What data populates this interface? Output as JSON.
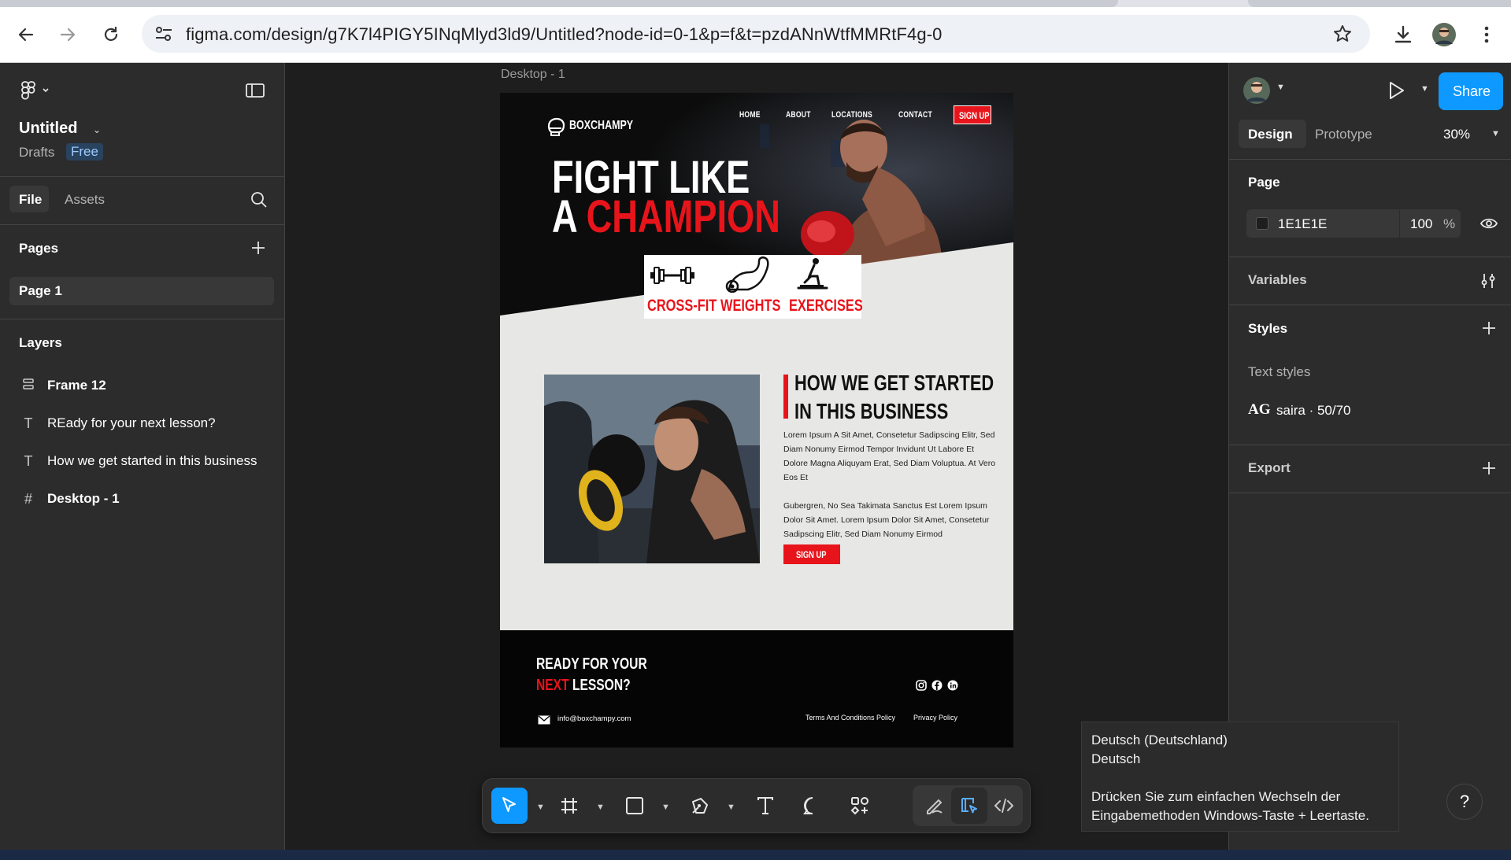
{
  "browser": {
    "url": "figma.com/design/g7K7l4PIGY5INqMlyd3ld9/Untitled?node-id=0-1&p=f&t=pzdANnWtfMMRtF4g-0"
  },
  "file": {
    "title": "Untitled",
    "location": "Drafts",
    "plan_badge": "Free"
  },
  "left_tabs": {
    "file": "File",
    "assets": "Assets"
  },
  "pages": {
    "heading": "Pages",
    "items": [
      "Page 1"
    ]
  },
  "layers": {
    "heading": "Layers",
    "items": [
      {
        "name": "Frame 12",
        "icon": "frame-icon"
      },
      {
        "name": "REady for your next lesson?",
        "icon": "text-icon"
      },
      {
        "name": "How we get started in this business",
        "icon": "text-icon"
      },
      {
        "name": "Desktop - 1",
        "icon": "hash-frame-icon"
      }
    ]
  },
  "canvas": {
    "frame_label": "Desktop - 1"
  },
  "site": {
    "logo": "BOXCHAMPY",
    "nav": [
      "HOME",
      "ABOUT",
      "LOCATIONS",
      "CONTACT"
    ],
    "nav_cta": "SIGN UP",
    "hero_line1": "FIGHT LIKE",
    "hero_line2_white": "A ",
    "hero_line2_red": "CHAMPION",
    "features": [
      "CROSS-FIT",
      "WEIGHTS",
      "EXERCISES"
    ],
    "about_title_1": "HOW WE GET STARTED",
    "about_title_2": "IN THIS BUSINESS",
    "about_p1": "Lorem Ipsum A Sit Amet, Consetetur Sadipscing Elitr, Sed Diam Nonumy Eirmod Tempor Invidunt Ut Labore Et Dolore Magna Aliquyam Erat, Sed Diam Voluptua. At Vero Eos Et",
    "about_p2": "Gubergren, No Sea Takimata Sanctus Est Lorem Ipsum Dolor Sit Amet. Lorem Ipsum Dolor Sit Amet, Consetetur Sadipscing Elitr, Sed Diam Nonumy Eirmod",
    "about_cta": "SIGN UP",
    "footer_line1": "READY FOR YOUR",
    "footer_next": "NEXT",
    "footer_lesson": " LESSON?",
    "email": "info@boxchampy.com",
    "terms": "Terms And Conditions Policy",
    "privacy": "Privacy Policy"
  },
  "right_panel": {
    "share": "Share",
    "tab_design": "Design",
    "tab_prototype": "Prototype",
    "zoom": "30%",
    "page_heading": "Page",
    "page_color": "1E1E1E",
    "page_opacity": "100",
    "percent": "%",
    "variables": "Variables",
    "styles": "Styles",
    "text_styles": "Text styles",
    "style_sample": "AG",
    "style_name": "saira · 50/70",
    "export": "Export"
  },
  "tooltip": {
    "line1": "Deutsch (Deutschland)",
    "line2": "Deutsch",
    "line3": "Drücken Sie zum einfachen Wechseln der",
    "line4": "Eingabemethoden Windows-Taste + Leertaste."
  },
  "help": "?",
  "colors": {
    "accent_blue": "#0d99ff",
    "brand_red": "#e8141b",
    "panel_bg": "#2c2c2c",
    "canvas_bg": "#1e1e1e"
  }
}
